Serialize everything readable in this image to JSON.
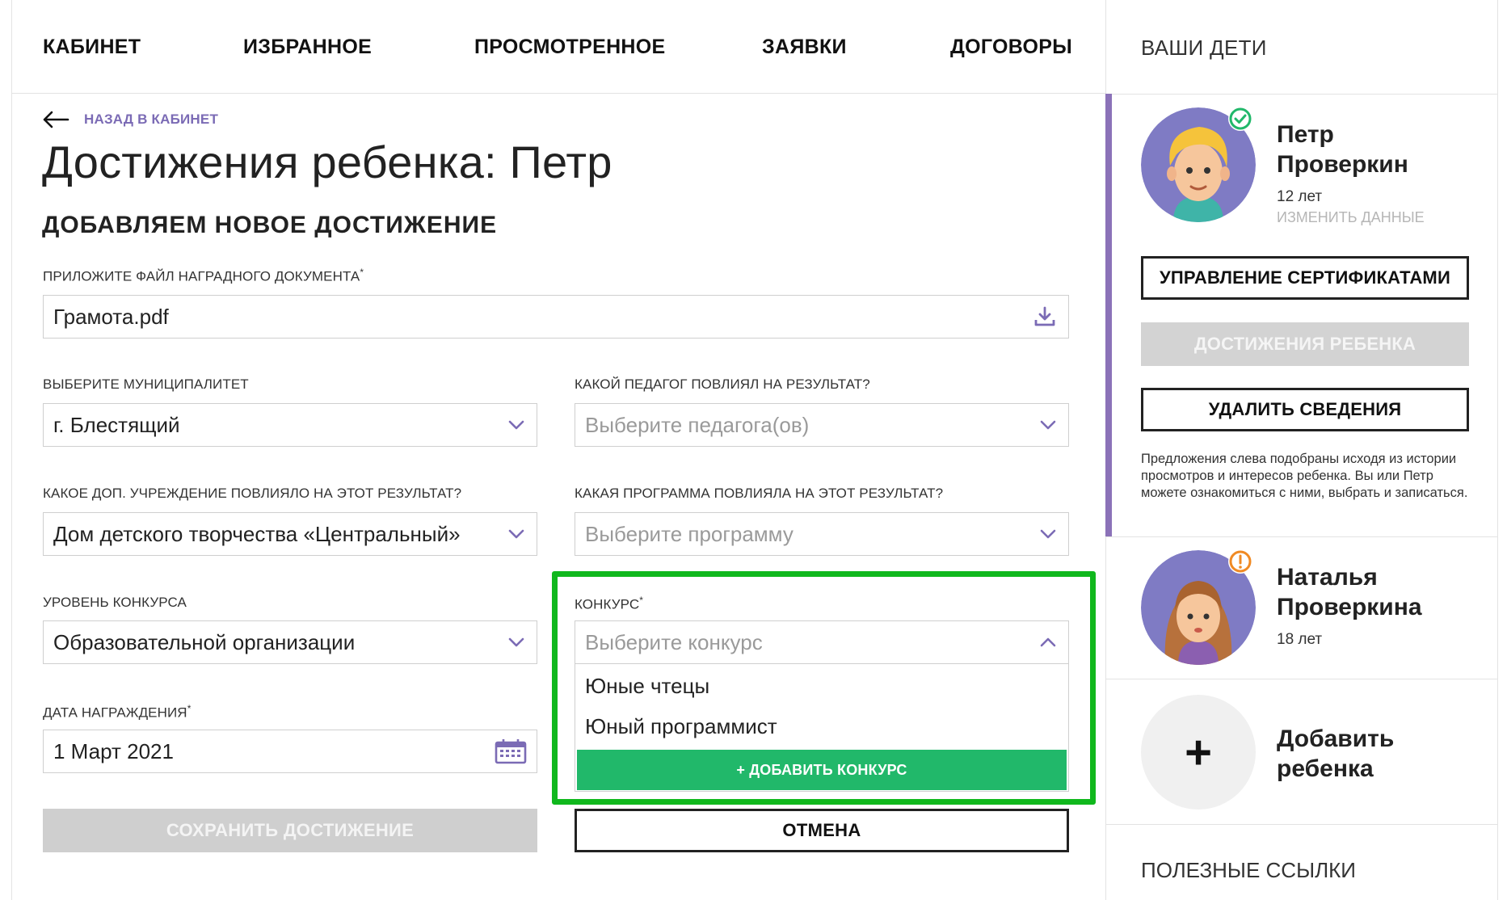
{
  "nav": {
    "cabinet": "КАБИНЕТ",
    "favorites": "ИЗБРАННОЕ",
    "viewed": "ПРОСМОТРЕННОЕ",
    "requests": "ЗАЯВКИ",
    "contracts": "ДОГОВОРЫ"
  },
  "back_label": "НАЗАД В КАБИНЕТ",
  "page_title": "Достижения ребенка: Петр",
  "section_title": "ДОБАВЛЯЕМ НОВОЕ ДОСТИЖЕНИЕ",
  "form": {
    "file": {
      "label": "ПРИЛОЖИТЕ ФАЙЛ НАГРАДНОГО ДОКУМЕНТА",
      "required": "*",
      "value": "Грамота.pdf"
    },
    "municipality": {
      "label": "ВЫБЕРИТЕ МУНИЦИПАЛИТЕТ",
      "value": "г. Блестящий"
    },
    "teacher": {
      "label": "КАКОЙ ПЕДАГОГ ПОВЛИЯЛ НА РЕЗУЛЬТАТ?",
      "placeholder": "Выберите педагога(ов)"
    },
    "institution": {
      "label": "КАКОЕ ДОП. УЧРЕЖДЕНИЕ ПОВЛИЯЛО НА ЭТОТ РЕЗУЛЬТАТ?",
      "value": "Дом детского творчества «Центральный»"
    },
    "program": {
      "label": "КАКАЯ ПРОГРАММА ПОВЛИЯЛА НА ЭТОТ РЕЗУЛЬТАТ?",
      "placeholder": "Выберите программу"
    },
    "level": {
      "label": "УРОВЕНЬ КОНКУРСА",
      "value": "Образовательной организации"
    },
    "contest": {
      "label": "КОНКУРС",
      "required": "*",
      "placeholder": "Выберите конкурс",
      "options": [
        "Юные чтецы",
        "Юный программист"
      ],
      "add_label": "+ ДОБАВИТЬ КОНКУРС"
    },
    "date": {
      "label": "ДАТА НАГРАЖДЕНИЯ",
      "required": "*",
      "value": "1 Март 2021"
    },
    "save_label": "СОХРАНИТЬ ДОСТИЖЕНИЕ",
    "cancel_label": "ОТМЕНА"
  },
  "sidebar": {
    "title": "ВАШИ ДЕТИ",
    "children": [
      {
        "first": "Петр",
        "last": "Проверкин",
        "age": "12 лет",
        "edit": "ИЗМЕНИТЬ ДАННЫЕ"
      },
      {
        "first": "Наталья",
        "last": "Проверкина",
        "age": "18 лет"
      }
    ],
    "buttons": {
      "certificates": "УПРАВЛЕНИЕ СЕРТИФИКАТАМИ",
      "achievements": "ДОСТИЖЕНИЯ РЕБЕНКА",
      "delete": "УДАЛИТЬ СВЕДЕНИЯ"
    },
    "hint": "Предложения слева подобраны исходя из истории просмотров и интересов ребенка. Вы или Петр можете ознакомиться с ними, выбрать и записаться.",
    "add_child_line1": "Добавить",
    "add_child_line2": "ребенка",
    "links_title": "ПОЛЕЗНЫЕ ССЫЛКИ"
  },
  "colors": {
    "accent_purple": "#8b72b8",
    "green": "#21b86a",
    "highlight": "#10b81d"
  }
}
